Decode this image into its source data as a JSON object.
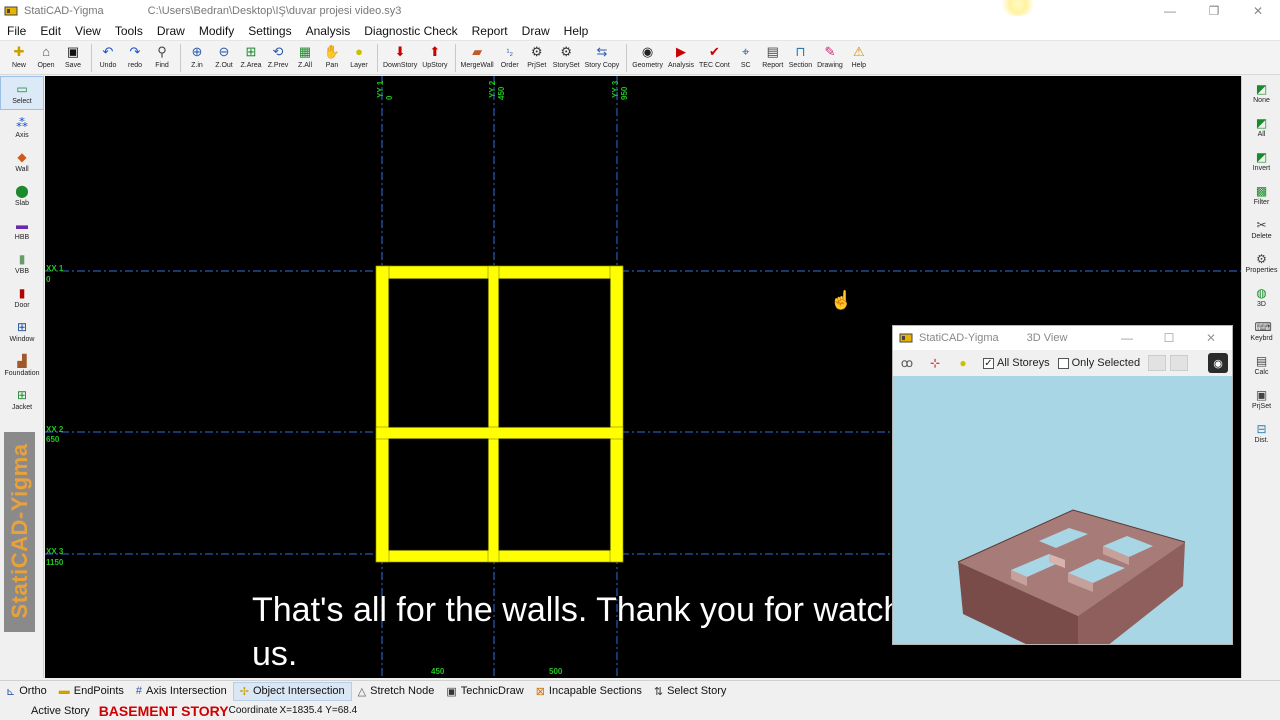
{
  "window": {
    "title": "StatiCAD-Yigma",
    "file_path": "C:\\Users\\Bedran\\Desktop\\IŞ\\duvar projesi video.sy3",
    "controls": [
      "—",
      "❐",
      "✕"
    ]
  },
  "menu": [
    "File",
    "Edit",
    "View",
    "Tools",
    "Draw",
    "Modify",
    "Settings",
    "Analysis",
    "Diagnostic Check",
    "Report",
    "Draw",
    "Help"
  ],
  "toolbar": [
    {
      "label": "New",
      "icon": "new-file-icon"
    },
    {
      "label": "Open",
      "icon": "open-folder-icon"
    },
    {
      "label": "Save",
      "icon": "save-disk-icon"
    },
    {
      "label": "Undo",
      "icon": "undo-icon"
    },
    {
      "label": "redo",
      "icon": "redo-icon"
    },
    {
      "label": "Find",
      "icon": "find-icon"
    },
    {
      "label": "Z.in",
      "icon": "zoom-in-icon"
    },
    {
      "label": "Z.Out",
      "icon": "zoom-out-icon"
    },
    {
      "label": "Z.Area",
      "icon": "zoom-area-icon"
    },
    {
      "label": "Z.Prev",
      "icon": "zoom-prev-icon"
    },
    {
      "label": "Z.All",
      "icon": "zoom-all-icon"
    },
    {
      "label": "Pan",
      "icon": "pan-hand-icon"
    },
    {
      "label": "Layer",
      "icon": "layer-bulb-icon"
    },
    {
      "label": "DownStory",
      "icon": "down-story-icon"
    },
    {
      "label": "UpStory",
      "icon": "up-story-icon"
    },
    {
      "label": "MergeWall",
      "icon": "merge-wall-icon"
    },
    {
      "label": "Order",
      "icon": "order-icon"
    },
    {
      "label": "PrjSet",
      "icon": "project-settings-icon"
    },
    {
      "label": "StorySet",
      "icon": "story-settings-icon"
    },
    {
      "label": "Story Copy",
      "icon": "story-copy-icon"
    },
    {
      "label": "Geometry",
      "icon": "geometry-icon"
    },
    {
      "label": "Analysis",
      "icon": "analysis-icon"
    },
    {
      "label": "TEC Cont",
      "icon": "tec-control-icon"
    },
    {
      "label": "SC",
      "icon": "sc-icon"
    },
    {
      "label": "Report",
      "icon": "report-icon"
    },
    {
      "label": "Section",
      "icon": "section-icon"
    },
    {
      "label": "Drawing",
      "icon": "drawing-icon"
    },
    {
      "label": "Help",
      "icon": "help-icon"
    }
  ],
  "left_tools": [
    {
      "label": "Select",
      "icon": "select-icon",
      "selected": true
    },
    {
      "label": "Axis",
      "icon": "axis-icon"
    },
    {
      "label": "Wall",
      "icon": "wall-icon"
    },
    {
      "label": "Slab",
      "icon": "slab-icon"
    },
    {
      "label": "HBB",
      "icon": "hbb-icon"
    },
    {
      "label": "VBB",
      "icon": "vbb-icon"
    },
    {
      "label": "Door",
      "icon": "door-icon"
    },
    {
      "label": "Window",
      "icon": "window-icon"
    },
    {
      "label": "Foundation",
      "icon": "foundation-icon"
    },
    {
      "label": "Jacket",
      "icon": "jacket-icon"
    }
  ],
  "logo_text": "StatiCAD-Yigma",
  "right_tools": [
    {
      "label": "None",
      "icon": "select-none-icon"
    },
    {
      "label": "All",
      "icon": "select-all-icon"
    },
    {
      "label": "Invert",
      "icon": "invert-selection-icon"
    },
    {
      "label": "Filter",
      "icon": "filter-icon"
    },
    {
      "label": "Delete",
      "icon": "delete-icon"
    },
    {
      "label": "Properties",
      "icon": "properties-icon"
    },
    {
      "label": "3D",
      "icon": "3d-view-icon"
    },
    {
      "label": "Keybrd",
      "icon": "keyboard-icon"
    },
    {
      "label": "Calc",
      "icon": "calculator-icon"
    },
    {
      "label": "PrjSet",
      "icon": "project-settings-icon"
    },
    {
      "label": "Dist.",
      "icon": "distance-icon"
    }
  ],
  "drawing": {
    "axes_y": [
      {
        "name": "YY 1",
        "value": "0"
      },
      {
        "name": "YY 2",
        "value": "450"
      },
      {
        "name": "YY 3",
        "value": "950"
      }
    ],
    "axes_x": [
      {
        "name": "XX 1",
        "value": "0"
      },
      {
        "name": "XX 2",
        "value": "650"
      },
      {
        "name": "XX 3",
        "value": "1150"
      }
    ],
    "bottom_dims": [
      "450",
      "500"
    ],
    "colors": {
      "wall": "#ffff00",
      "axis": "#2f6fd8",
      "axis_label": "#22c322",
      "background": "#000000"
    }
  },
  "subtitle": [
    "That's all for the walls. Thank you for watching",
    "us."
  ],
  "view3d": {
    "title": "StatiCAD-Yigma",
    "subtitle": "3D View",
    "all_storeys_label": "All Storeys",
    "all_storeys_checked": true,
    "only_selected_label": "Only Selected",
    "only_selected_checked": false
  },
  "status": [
    {
      "label": "Ortho",
      "icon": "ortho-icon",
      "on": false
    },
    {
      "label": "EndPoints",
      "icon": "endpoints-icon",
      "on": false
    },
    {
      "label": "Axis Intersection",
      "icon": "axis-intersection-icon",
      "on": false
    },
    {
      "label": "Object Intersection",
      "icon": "object-intersection-icon",
      "on": true
    },
    {
      "label": "Stretch Node",
      "icon": "stretch-node-icon",
      "on": false
    },
    {
      "label": "TechnicDraw",
      "icon": "technic-draw-icon",
      "on": false
    },
    {
      "label": "Incapable Sections",
      "icon": "incapable-sections-icon",
      "on": false
    },
    {
      "label": "Select Story",
      "icon": "select-story-icon",
      "on": false
    }
  ],
  "info": {
    "active_story_label": "Active Story",
    "story": "BASEMENT STORY",
    "coord_label": "Coordinate",
    "coord_value": "X=1835.4   Y=68.4"
  }
}
